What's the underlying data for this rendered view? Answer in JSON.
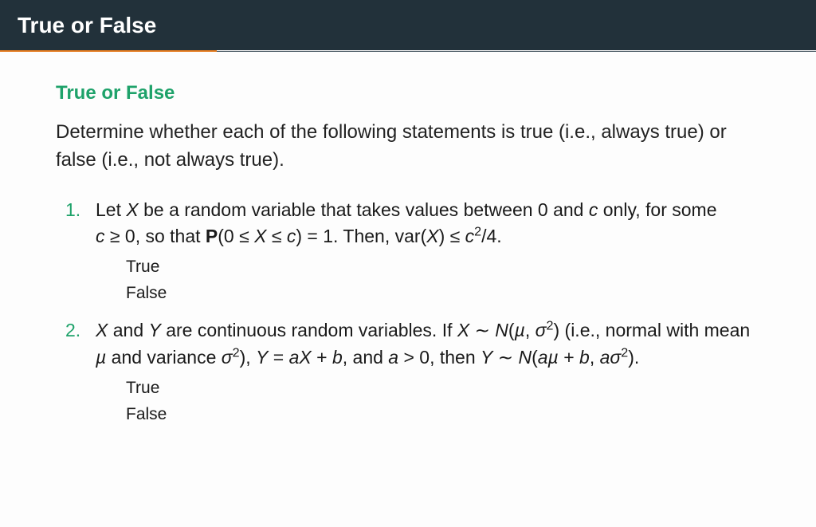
{
  "titlebar": {
    "title": "True or False"
  },
  "section": {
    "heading": "True or False",
    "intro": "Determine whether each of the following statements is true (i.e., always true) or false (i.e., not always true)."
  },
  "questions": [
    {
      "parts": {
        "t1": "Let ",
        "X": "X",
        "t2": " be a random variable that takes values between 0 and ",
        "c1": "c",
        "t3": " only, for some ",
        "c2": "c",
        "ge": " ≥ 0",
        "t4": ", so that ",
        "P": "P",
        "paren_open": "(0 ≤ ",
        "X2": "X",
        "le_c": " ≤ ",
        "c3": "c",
        "close_eq": ") = 1. Then, ",
        "var": "var",
        "X3": "X",
        "le": ") ≤ ",
        "c4": "c",
        "sq_over4": "/4.",
        "two": "2"
      },
      "answers": {
        "true": "True",
        "false": "False"
      }
    },
    {
      "parts": {
        "X": "X",
        "and": " and ",
        "Y": "Y",
        "t1": " are continuous random variables. If ",
        "X2": "X",
        "sim": " ∼ ",
        "N": "N",
        "open": "(",
        "mu": "µ",
        "comma": ", ",
        "sigma": "σ",
        "two": "2",
        "close": ")",
        "ie": " (i.e., normal with mean ",
        "mu2": "µ",
        "andvar": " and variance ",
        "sigma2": "σ",
        "close2": "), ",
        "Y2": "Y",
        "eq": " = ",
        "a": "a",
        "X3": "X",
        "plus": " + ",
        "b": "b",
        "andagt": ", and ",
        "a2": "a",
        "gt0": " > 0, then ",
        "Y3": "Y",
        "sim2": " ∼ ",
        "N2": "N",
        "open2": "(",
        "a3": "a",
        "mu3": "µ",
        "plus2": " + ",
        "b2": "b",
        "comma2": ", ",
        "a4": "a",
        "sigma3": "σ",
        "close3": ")."
      },
      "answers": {
        "true": "True",
        "false": "False"
      }
    }
  ]
}
